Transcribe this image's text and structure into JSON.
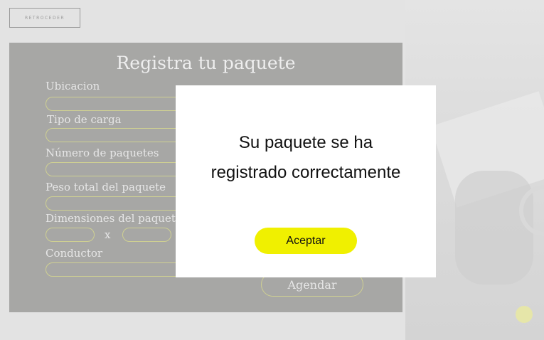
{
  "nav": {
    "back_label": "RETROCEDER"
  },
  "form": {
    "title": "Registra tu paquete",
    "fields": [
      {
        "label": "Ubicacion",
        "value": ""
      },
      {
        "label": "Tipo de carga",
        "value": ""
      },
      {
        "label": "Número de paquetes",
        "value": ""
      },
      {
        "label": "Peso total del paquete",
        "value": ""
      },
      {
        "label": "Dimensiones del paquete",
        "value": ""
      },
      {
        "label": "Conductor",
        "value": ""
      }
    ],
    "dimension_separator": "x",
    "submit_label": "Agendar"
  },
  "modal": {
    "line1": "Su paquete se ha",
    "line2": "registrado correctamente",
    "accept_label": "Aceptar"
  },
  "colors": {
    "panel": "#a7a7a5",
    "input_border": "#cfd092",
    "accept_button": "#f0f000",
    "modal_bg": "#ffffff"
  }
}
